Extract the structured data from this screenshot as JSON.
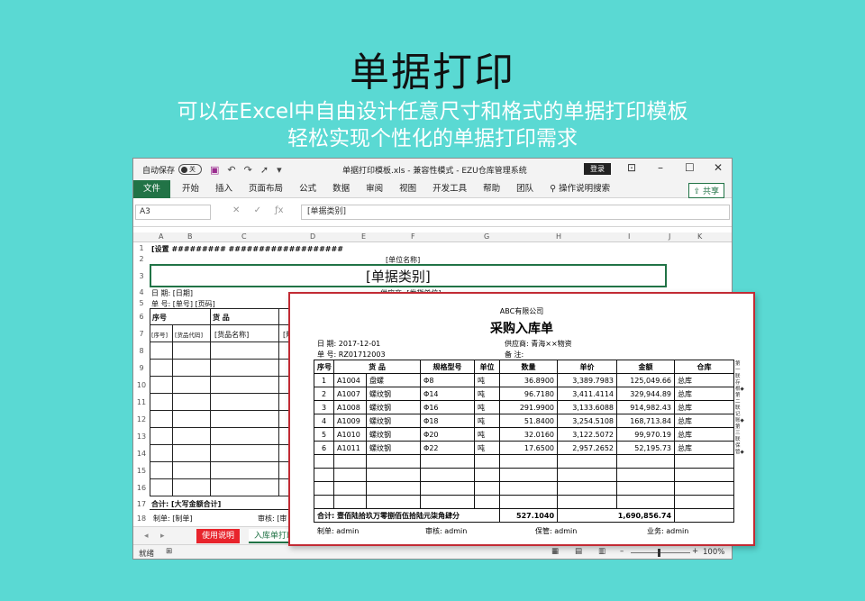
{
  "hero": {
    "title": "单据打印",
    "subtitle_line1": "可以在Excel中自由设计任意尺寸和格式的单据打印模板",
    "subtitle_line2": "轻松实现个性化的单据打印需求"
  },
  "window": {
    "autosave_label": "自动保存",
    "autosave_state": "关",
    "doc_title": "单据打印模板.xls  -  兼容性模式  -  EZU仓库管理系统",
    "login_label": "登录",
    "share_label": "共享",
    "tabs": [
      "文件",
      "开始",
      "插入",
      "页面布局",
      "公式",
      "数据",
      "审阅",
      "视图",
      "开发工具",
      "帮助",
      "团队"
    ],
    "search_hint": "操作说明搜索",
    "name_box": "A3",
    "formula_value": "[单据类别]"
  },
  "sheet": {
    "columns": [
      "A",
      "B",
      "C",
      "D",
      "E",
      "F",
      "G",
      "H",
      "I",
      "J",
      "K"
    ],
    "rows": [
      "1",
      "2",
      "3",
      "4",
      "5",
      "6",
      "7",
      "8",
      "9",
      "10",
      "11",
      "12",
      "13",
      "14",
      "15",
      "16",
      "17",
      "18"
    ],
    "r1": "[设置 ######### ###################",
    "unit_name": "[单位名称]",
    "doc_category": "[单据类别]",
    "date_label": "日    期: [日期]",
    "supplier_label": "供应商: [发货单位]",
    "no_label": "单    号: [单号]    [页码]",
    "col_seq": "序号",
    "col_goods": "货    品",
    "r7_seq": "[序号]",
    "r7_code": "[货品代码]",
    "r7_name": "[货品名称]",
    "r7_spec": "[规",
    "total_label": "合计: [大写金额合计]",
    "maker_label": "制单: [制单]",
    "review_label": "审核: [审"
  },
  "sheet_tabs": {
    "help": "使用说明",
    "stock_in": "入库单打印"
  },
  "status": {
    "ready": "就绪",
    "zoom": "100%"
  },
  "preview": {
    "company": "ABC有限公司",
    "title": "采购入库单",
    "date": "日    期: 2017-12-01",
    "supplier": "供应商: 青海××物资",
    "doc_no": "单    号: RZ01712003",
    "remark": "备    注:",
    "headers": [
      "序号",
      "货    品",
      "规格型号",
      "单位",
      "数量",
      "单价",
      "金额",
      "仓库"
    ],
    "rows": [
      [
        "1",
        "A1004",
        "盘螺",
        "Φ8",
        "吨",
        "36.8900",
        "3,389.7983",
        "125,049.66",
        "总库"
      ],
      [
        "2",
        "A1007",
        "螺纹钢",
        "Φ14",
        "吨",
        "96.7180",
        "3,411.4114",
        "329,944.89",
        "总库"
      ],
      [
        "3",
        "A1008",
        "螺纹钢",
        "Φ16",
        "吨",
        "291.9900",
        "3,133.6088",
        "914,982.43",
        "总库"
      ],
      [
        "4",
        "A1009",
        "螺纹钢",
        "Φ18",
        "吨",
        "51.8400",
        "3,254.5108",
        "168,713.84",
        "总库"
      ],
      [
        "5",
        "A1010",
        "螺纹钢",
        "Φ20",
        "吨",
        "32.0160",
        "3,122.5072",
        "99,970.19",
        "总库"
      ],
      [
        "6",
        "A1011",
        "螺纹钢",
        "Φ22",
        "吨",
        "17.6500",
        "2,957.2652",
        "52,195.73",
        "总库"
      ]
    ],
    "total_label": "合计: 壹佰陆拾玖万零捌佰伍拾陆元柒角肆分",
    "total_qty": "527.1040",
    "total_amount": "1,690,856.74",
    "maker": "制单: admin",
    "reviewer": "审核: admin",
    "keeper": "保管: admin",
    "business": "业务: admin",
    "side_note": "第一联存根◆第二联记账◆第三联保管◆"
  }
}
